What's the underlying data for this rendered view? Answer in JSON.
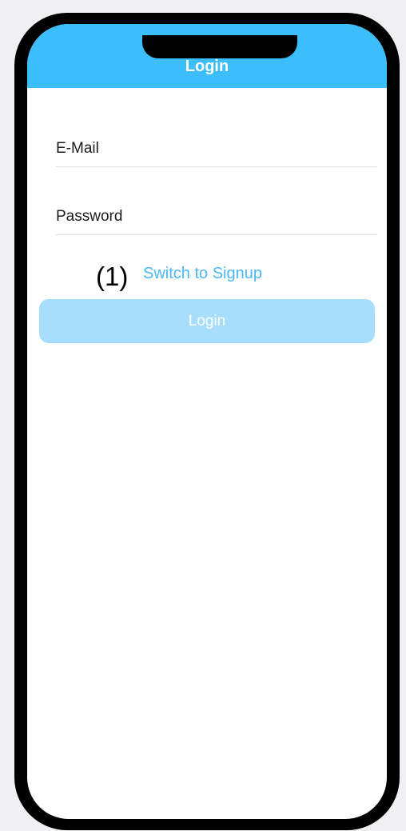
{
  "header": {
    "title": "Login"
  },
  "form": {
    "email_placeholder": "E-Mail",
    "password_placeholder": "Password",
    "annotation": "(1)",
    "switch_label": "Switch to Signup",
    "login_label": "Login"
  },
  "colors": {
    "header": "#3dbefc",
    "link": "#4ab8f5",
    "button_disabled": "#a8defd",
    "phone_frame": "#000000"
  }
}
